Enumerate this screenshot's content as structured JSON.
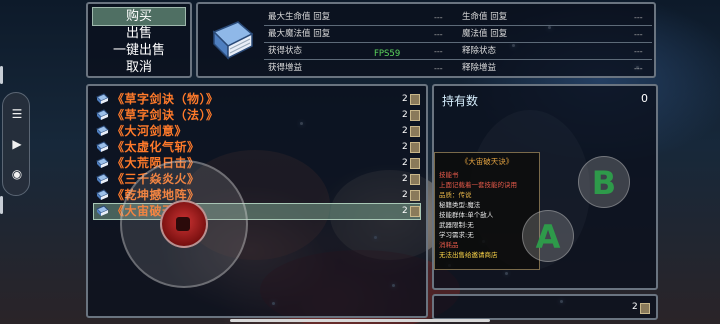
{
  "menu": {
    "items": [
      "购买",
      "出售",
      "一键出售",
      "取消"
    ],
    "selected_index": 0
  },
  "detail": {
    "stats": [
      {
        "left": "最大生命值 回复",
        "left_val": "---",
        "right": "生命值 回复",
        "right_val": "---"
      },
      {
        "left": "最大魔法值 回复",
        "left_val": "---",
        "right": "魔法值 回复",
        "right_val": "---"
      },
      {
        "left": "获得状态",
        "left_val": "---",
        "right": "释除状态",
        "right_val": "---"
      },
      {
        "left": "获得增益",
        "left_val": "---",
        "right": "释除增益",
        "right_val": "---"
      }
    ],
    "fps": "FPS59",
    "icon": "blue-book-icon"
  },
  "inventory": {
    "items": [
      {
        "name": "《草字剑诀（物）》",
        "count": "2"
      },
      {
        "name": "《草字剑诀（法）》",
        "count": "2"
      },
      {
        "name": "《大河剑意》",
        "count": "2"
      },
      {
        "name": "《太虚化气斩》",
        "count": "2"
      },
      {
        "name": "《大荒陨日击》",
        "count": "2"
      },
      {
        "name": "《三千焱炎火》",
        "count": "2"
      },
      {
        "name": "《乾坤撼地阵》",
        "count": "2"
      },
      {
        "name": "《大宙破天诀》",
        "count": "2"
      }
    ],
    "selected_index": 7
  },
  "info": {
    "title": "持有数",
    "count": "0",
    "card": {
      "title": "《大宙破天诀》",
      "lines": [
        "技能书",
        "上面记载着一套技能的诀用",
        "品质：传说",
        "秘籍类型:魔法",
        "技能群体:单个敌人",
        "武器限制:无",
        "学习需求:无",
        "消耗品",
        "无法出售给邀请商店"
      ]
    }
  },
  "bottom": {
    "count": "2"
  },
  "controls": {
    "button_b": "B",
    "button_a": "A"
  },
  "colors": {
    "accent_orange": "#ff7a2a",
    "highlight_green": "#4f6f63",
    "button_letter": "#2e9a4a"
  }
}
